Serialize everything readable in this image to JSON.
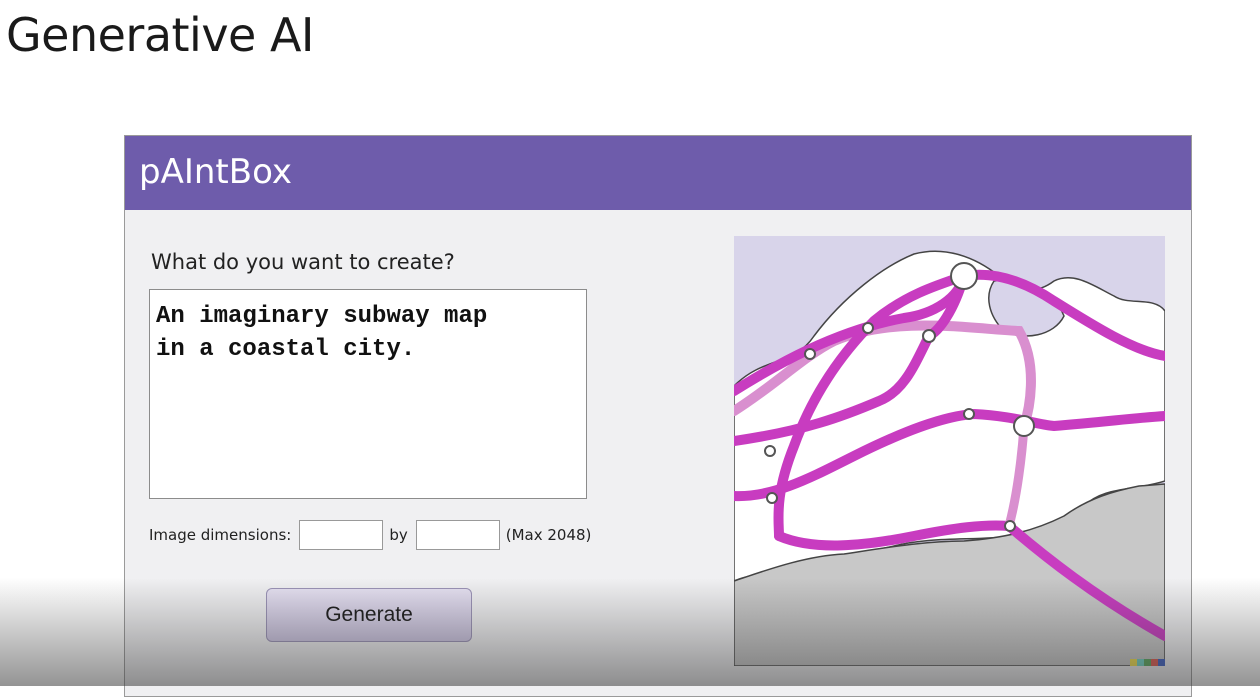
{
  "slide": {
    "title": "Generative AI"
  },
  "app": {
    "name": "pAIntBox",
    "prompt_label": "What do you want to create?",
    "prompt_value": "An imaginary subway map\nin a coastal city.",
    "dimensions_label": "Image dimensions:",
    "width_value": "",
    "by_label": "by",
    "height_value": "",
    "max_label": "(Max 2048)",
    "generate_label": "Generate"
  },
  "colors": {
    "header": "#6e5cab",
    "line_primary": "#c83cc0",
    "line_secondary": "#d98fcf",
    "water": "#d8d4ea",
    "land": "#c8c8c8"
  }
}
